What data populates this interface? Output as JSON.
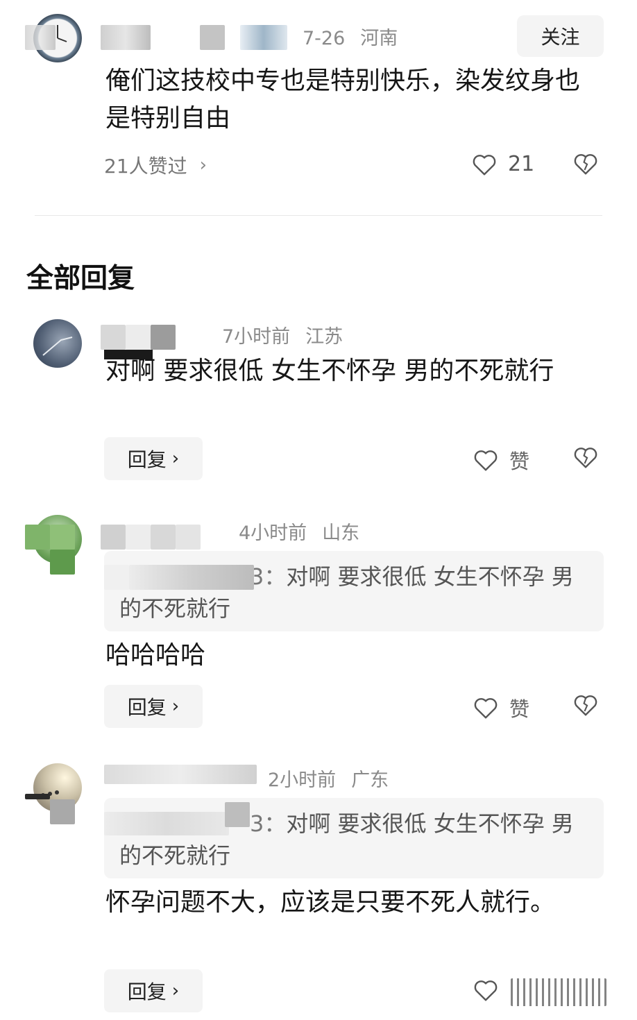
{
  "main_comment": {
    "date": "7-26",
    "location": "河南",
    "follow_label": "关注",
    "text": "俺们这技校中专也是特别快乐，染发纹身也是特别自由",
    "likes_summary": "21人赞过",
    "like_count": "21"
  },
  "replies_section": {
    "title": "全部回复"
  },
  "replies": [
    {
      "time": "7小时前",
      "location": "江苏",
      "text": "对啊 要求很低 女生不怀孕 男的不死就行",
      "reply_label": "回复",
      "like_label": "赞"
    },
    {
      "time": "4小时前",
      "location": "山东",
      "quote_name": "3：",
      "quote_text": "对啊 要求很低 女生不怀孕 男的不死就行",
      "text": "哈哈哈哈",
      "reply_label": "回复",
      "like_label": "赞"
    },
    {
      "time": "2小时前",
      "location": "广东",
      "quote_name": "3：",
      "quote_text": "对啊 要求很低 女生不怀孕 男的不死就行",
      "text": "怀孕问题不大，应该是只要不死人就行。",
      "reply_label": "回复"
    }
  ],
  "icons": {
    "like": "heart-outline-icon",
    "dislike": "broken-heart-icon",
    "chevron": "chevron-right-icon"
  },
  "colors": {
    "background": "#ffffff",
    "text": "#161616",
    "meta": "#8a8a8a",
    "button_bg": "#f4f4f4",
    "quote_bg": "#f5f5f5"
  }
}
